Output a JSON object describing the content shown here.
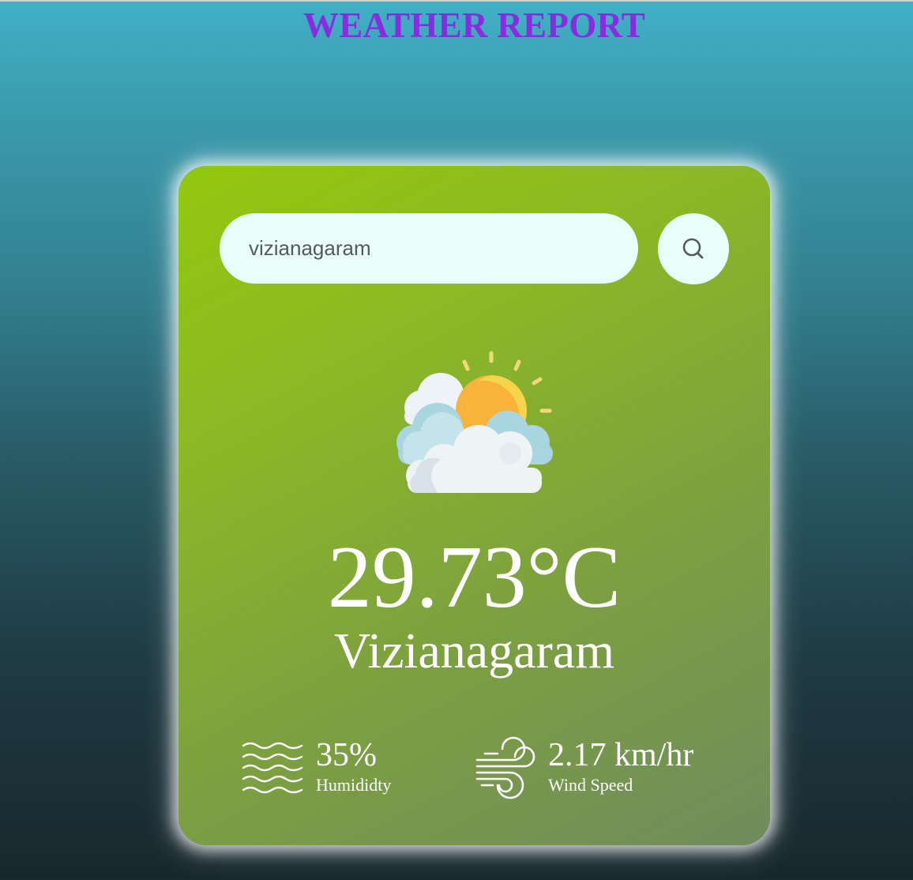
{
  "page": {
    "title": "WEATHER REPORT"
  },
  "search": {
    "value": "vizianagaram",
    "placeholder": "",
    "button_icon": "search-icon"
  },
  "weather": {
    "condition_icon": "partly-cloudy-sun-icon",
    "temperature": "29.73°C",
    "city": "Vizianagaram"
  },
  "details": {
    "humidity": {
      "icon": "humidity-icon",
      "value": "35%",
      "label": "Humididty"
    },
    "wind": {
      "icon": "wind-icon",
      "value": "2.17 km/hr",
      "label": "Wind Speed"
    }
  },
  "colors": {
    "title": "#8a2be2",
    "card_gradient_start": "#93c80e",
    "card_gradient_end": "#6f8c5d",
    "input_background": "#eafffc",
    "text": "#ffffff"
  }
}
